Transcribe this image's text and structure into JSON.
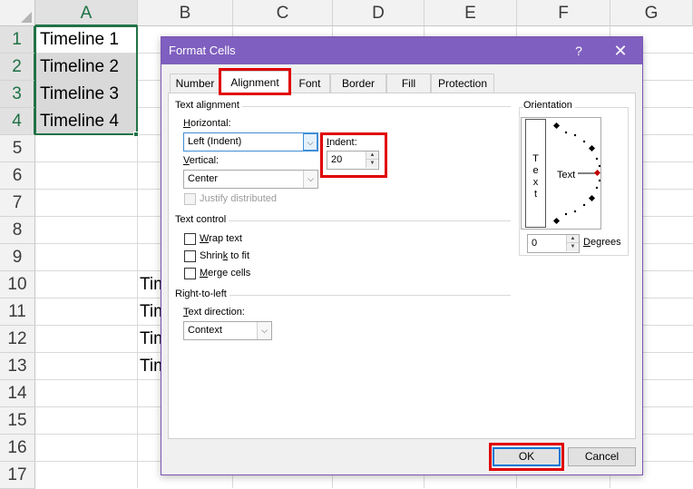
{
  "sheet": {
    "columns": [
      "A",
      "B",
      "C",
      "D",
      "E",
      "F",
      "G"
    ],
    "selected_column": "A",
    "rows": [
      "1",
      "2",
      "3",
      "4",
      "5",
      "6",
      "7",
      "8",
      "9",
      "10",
      "11",
      "12",
      "13",
      "14",
      "15",
      "16",
      "17"
    ],
    "cells_a": [
      "Timeline 1",
      "Timeline 2",
      "Timeline 3",
      "Timeline 4"
    ],
    "cells_b": [
      "Tim",
      "Tim",
      "Tim",
      "Tim"
    ],
    "colors": {
      "selection": "#217346",
      "cell_fill": "#d9d9d9"
    }
  },
  "dialog": {
    "title": "Format Cells",
    "help_glyph": "?",
    "close_glyph": "✕",
    "tabs": [
      "Number",
      "Alignment",
      "Font",
      "Border",
      "Fill",
      "Protection"
    ],
    "active_tab": "Alignment",
    "text_alignment": {
      "group_label": "Text alignment",
      "horizontal_label_u": "H",
      "horizontal_label_rest": "orizontal:",
      "horizontal_value": "Left (Indent)",
      "vertical_label_u": "V",
      "vertical_label_rest": "ertical:",
      "vertical_value": "Center",
      "indent_label_u": "I",
      "indent_label_rest": "ndent:",
      "indent_value": "20",
      "justify_distributed": "Justify distributed"
    },
    "text_control": {
      "group_label": "Text control",
      "wrap_u": "W",
      "wrap_rest": "rap text",
      "shrink_pre": "Shrin",
      "shrink_u": "k",
      "shrink_rest": " to fit",
      "merge_u": "M",
      "merge_rest": "erge cells"
    },
    "rtl": {
      "group_label": "Right-to-left",
      "direction_label_u": "T",
      "direction_label_rest": "ext direction:",
      "direction_value": "Context"
    },
    "orientation": {
      "group_label": "Orientation",
      "vertical_text": [
        "T",
        "e",
        "x",
        "t"
      ],
      "horizontal_text": "Text",
      "degrees_value": "0",
      "degrees_label_u": "D",
      "degrees_label_rest": "egrees"
    },
    "buttons": {
      "ok": "OK",
      "cancel": "Cancel"
    },
    "colors": {
      "titlebar": "#7f5fbf",
      "highlight": "#e00000",
      "indicator": "#c00000"
    }
  }
}
